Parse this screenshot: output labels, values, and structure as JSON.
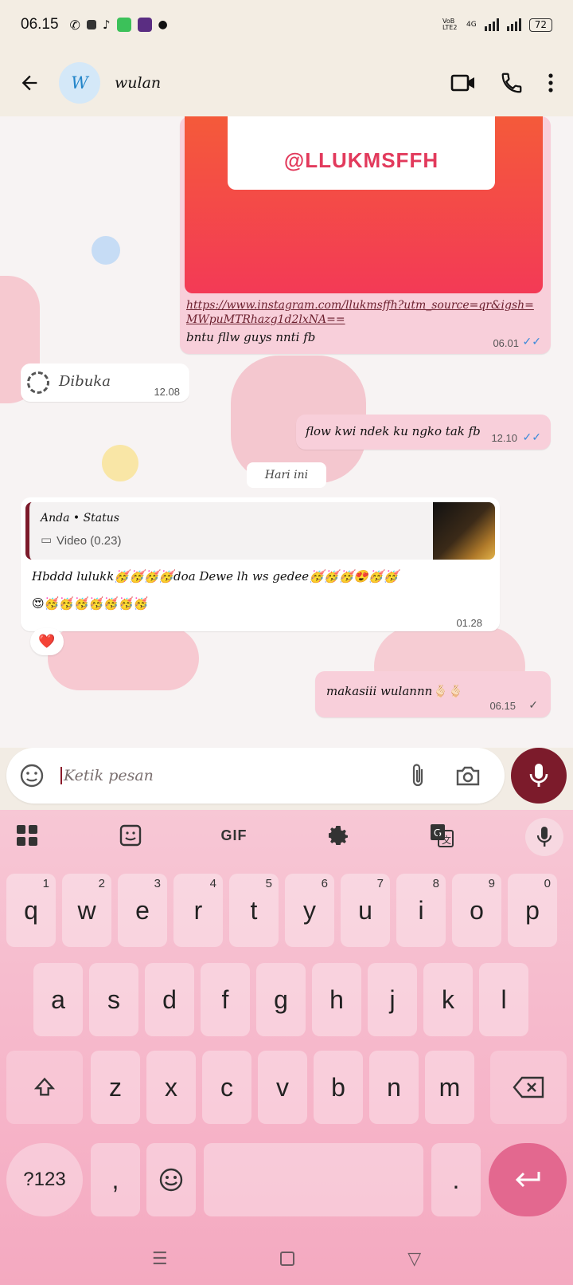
{
  "status_bar": {
    "time": "06.15",
    "network_label": "VoB LTE2",
    "network_type": "4G",
    "battery": "72"
  },
  "header": {
    "avatar_initial": "W",
    "contact_name": "wulan"
  },
  "messages": {
    "insta_handle": "@LLUKMSFFH",
    "insta_link": "https://www.instagram.com/llukmsffh?utm_source=qr&igsh=MWpuMTRhazg1d2lxNA==",
    "insta_caption": "bntu fllw guys nnti fb",
    "insta_time": "06.01",
    "viewonce_label": "Dibuka",
    "viewonce_time": "12.08",
    "flow_text": "flow kwi ndek ku ngko tak fb",
    "flow_time": "12.10",
    "date_chip": "Hari ini",
    "reply_author": "Anda • Status",
    "reply_kind": "Video (0.23)",
    "birthday_text": "Hbddd lulukk🥳🥳🥳🥳doa Dewe lh ws gedee🥳🥳🥳😍🥳🥳",
    "birthday_text_2": "😍🥳🥳🥳🥳🥳🥳🥳",
    "birthday_time": "01.28",
    "reaction": "❤️",
    "last_text": "makasiii wulannn🫰🏻🫰🏻",
    "last_time": "06.15"
  },
  "composer": {
    "placeholder": "Ketik pesan"
  },
  "keyboard": {
    "gif_label": "GIF",
    "row1": [
      "q",
      "w",
      "e",
      "r",
      "t",
      "y",
      "u",
      "i",
      "o",
      "p"
    ],
    "row1_hints": [
      "1",
      "2",
      "3",
      "4",
      "5",
      "6",
      "7",
      "8",
      "9",
      "0"
    ],
    "row2": [
      "a",
      "s",
      "d",
      "f",
      "g",
      "h",
      "j",
      "k",
      "l"
    ],
    "row3": [
      "z",
      "x",
      "c",
      "v",
      "b",
      "n",
      "m"
    ],
    "num_label": "?123",
    "comma": ",",
    "period": "."
  },
  "colors": {
    "outgoing_bubble": "#f8cfda",
    "accent_dark": "#7c1b2b",
    "enter_key": "#e3688f",
    "read_ticks": "#3b8ad9"
  }
}
